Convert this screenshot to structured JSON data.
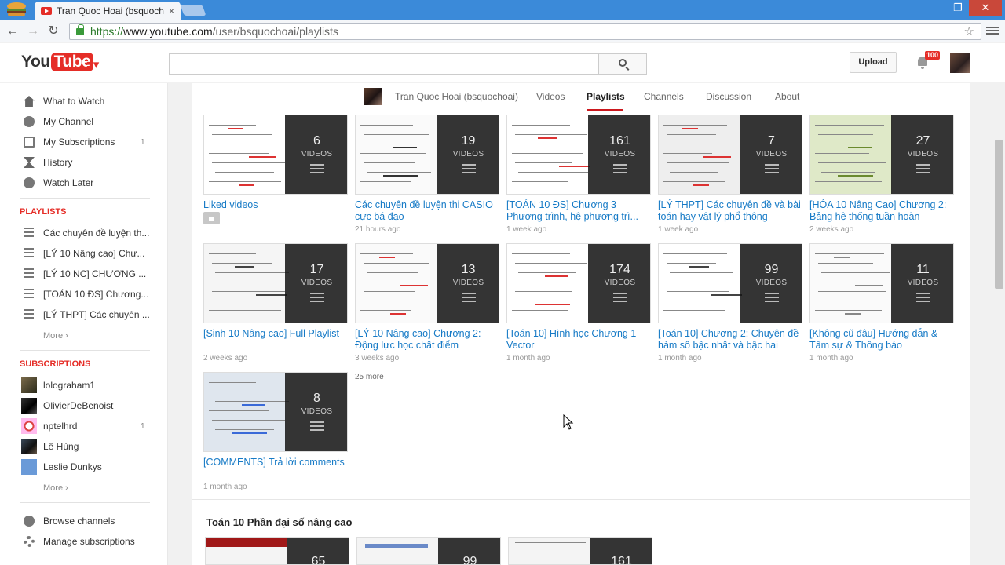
{
  "browser": {
    "tab_title": "Tran Quoc Hoai (bsquoch",
    "tab_close": "×",
    "url_scheme": "https://",
    "url_host": "www.youtube.com",
    "url_path": "/user/bsquochoai/playlists",
    "back": "←",
    "forward": "→",
    "reload": "↻",
    "star": "☆",
    "minimize": "—",
    "maximize": "❐",
    "close": "✕"
  },
  "header": {
    "logo_you": "You",
    "logo_tube": "Tube",
    "guide": "≡▾",
    "search_placeholder": "",
    "upload_label": "Upload",
    "notification_count": "100"
  },
  "sidebar": {
    "nav": [
      {
        "label": "What to Watch",
        "icon": "home-icon"
      },
      {
        "label": "My Channel",
        "icon": "person-icon"
      },
      {
        "label": "My Subscriptions",
        "icon": "subscriptions-icon",
        "count": "1"
      },
      {
        "label": "History",
        "icon": "hourglass-icon"
      },
      {
        "label": "Watch Later",
        "icon": "clock-icon"
      }
    ],
    "playlists_title": "PLAYLISTS",
    "playlists": [
      {
        "label": "Các chuyên đề luyện th..."
      },
      {
        "label": "[LÝ 10 Nâng cao] Chư..."
      },
      {
        "label": "[LÝ 10 NC] CHƯƠNG ..."
      },
      {
        "label": "[TOÁN 10 ĐS] Chương..."
      },
      {
        "label": "[LÝ THPT] Các chuyên ..."
      }
    ],
    "playlists_more": "More ›",
    "subscriptions_title": "SUBSCRIPTIONS",
    "subscriptions": [
      {
        "label": "lolograham1",
        "count": ""
      },
      {
        "label": "OlivierDeBenoist",
        "count": ""
      },
      {
        "label": "nptelhrd",
        "count": "1"
      },
      {
        "label": "Lê Hùng",
        "count": ""
      },
      {
        "label": "Leslie Dunkys",
        "count": ""
      }
    ],
    "subscriptions_more": "More ›",
    "footer": [
      {
        "label": "Browse channels",
        "icon": "plus-circle-icon"
      },
      {
        "label": "Manage subscriptions",
        "icon": "gear-icon"
      }
    ]
  },
  "channel_nav": {
    "channel_name": "Tran Quoc Hoai (bsquochoai)",
    "tabs": [
      "Videos",
      "Playlists",
      "Channels",
      "Discussion",
      "About"
    ],
    "active_tab": "Playlists"
  },
  "playlists": [
    {
      "title": "Liked videos",
      "count": "6",
      "unit": "VIDEOS",
      "meta": "",
      "private": true
    },
    {
      "title": "Các chuyên đề luyện thi CASIO cực bá đạo",
      "count": "19",
      "unit": "VIDEOS",
      "meta": "21 hours ago"
    },
    {
      "title": "[TOÁN 10 ĐS] Chương 3 Phương trình, hệ phương trì...",
      "count": "161",
      "unit": "VIDEOS",
      "meta": "1 week ago"
    },
    {
      "title": "[LÝ THPT] Các chuyên đề và bài toán hay vật lý phổ thông",
      "count": "7",
      "unit": "VIDEOS",
      "meta": "1 week ago"
    },
    {
      "title": "[HÓA 10 Nâng Cao] Chương 2: Bảng hệ thống tuần hoàn",
      "count": "27",
      "unit": "VIDEOS",
      "meta": "2 weeks ago"
    },
    {
      "title": "[Sinh 10 Nâng cao] Full Playlist",
      "count": "17",
      "unit": "VIDEOS",
      "meta": "2 weeks ago"
    },
    {
      "title": "[LÝ 10 Nâng cao] Chương 2: Động lực học chất điểm",
      "count": "13",
      "unit": "VIDEOS",
      "meta": "3 weeks ago"
    },
    {
      "title": "[Toán 10] Hình học Chương 1 Vector",
      "count": "174",
      "unit": "VIDEOS",
      "meta": "1 month ago"
    },
    {
      "title": "[Toán 10] Chương 2: Chuyên đề hàm số bậc nhất và bậc hai",
      "count": "99",
      "unit": "VIDEOS",
      "meta": "1 month ago"
    },
    {
      "title": "[Không cũ đâu] Hướng dẫn & Tâm sự & Thông báo",
      "count": "11",
      "unit": "VIDEOS",
      "meta": "1 month ago"
    },
    {
      "title": "[COMMENTS] Trả lời comments",
      "count": "8",
      "unit": "VIDEOS",
      "meta": "1 month ago"
    }
  ],
  "more_count": "25 more",
  "section": {
    "title": "Toán 10 Phần đại số nâng cao",
    "counts": [
      "65",
      "99",
      "161"
    ]
  },
  "colors": {
    "accent": "#e52d27",
    "link": "#167ac6",
    "active_underline": "#cc181e"
  }
}
